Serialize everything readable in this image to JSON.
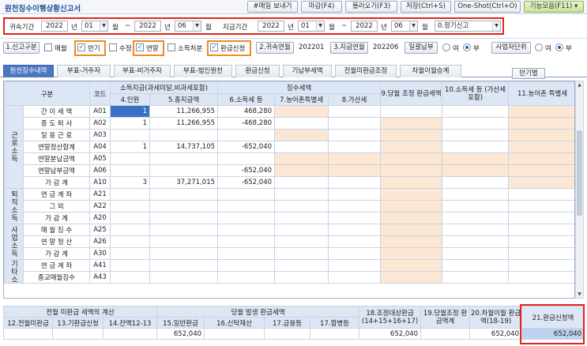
{
  "title": "원천징수이행상황신고서",
  "toolbar": {
    "email": "#메일 보내기",
    "close": "마감(F4)",
    "load": "불러오기(F3)",
    "save": "저장(Ctrl+S)",
    "oneshot": "One-Shot(Ctrl+O)",
    "func": "기능모음(F11)"
  },
  "period": {
    "label1": "귀속기간",
    "from_year": "2022",
    "from_month": "01",
    "to_year": "2022",
    "to_month": "06",
    "year": "년",
    "month": "월",
    "tilde": "~",
    "label2": "지급기간",
    "pay_from_year": "2022",
    "pay_from_month": "01",
    "pay_to_year": "2022",
    "pay_to_month": "06",
    "report_type": "0.정기신고"
  },
  "options": {
    "report_category_btn": "1.신고구분",
    "monthly": "매월",
    "semiannual": "반기",
    "amend": "수정",
    "yearend": "연말",
    "income_disposal": "소득처분",
    "refund": "환급신청",
    "attr_year_btn": "2.귀속연월",
    "attr_year_value": "202201",
    "pay_year_btn": "3.지급연월",
    "pay_year_value": "202206",
    "lump_btn": "일괄납부",
    "yes": "여",
    "no": "부",
    "biz_unit_btn": "사업자단위",
    "yes2": "여",
    "no2": "부"
  },
  "tabs": [
    "원천징수내역",
    "부표-거주자",
    "부표-비거주자",
    "부표-법인원천",
    "환급신청",
    "기납부세액",
    "전월미환급조정",
    "차월이월승계"
  ],
  "side_button": "반기별",
  "grid": {
    "headers": {
      "category": "구분",
      "code": "코드",
      "income_group": "소득지급(과세미달,비과세포함)",
      "withholding_group": "징수세액",
      "col4": "4.인원",
      "col5": "5.총지급액",
      "col6": "6.소득세 등",
      "col7": "7.농어촌특별세",
      "col8": "8.가산세",
      "col9": "9.당월 조정 환급세액",
      "col10": "10.소득세 등 (가산세 포함)",
      "col11": "11.농어촌 특별세"
    },
    "groups": {
      "earned": "근로소득",
      "retire": "퇴직소득",
      "business": "사업소득",
      "other": "기타소득"
    },
    "rows": [
      {
        "label": "간 이 세 액",
        "code": "A01",
        "persons": "1",
        "total": "11,266,955",
        "tax": "468,280"
      },
      {
        "label": "중 도 퇴 사",
        "code": "A02",
        "persons": "1",
        "total": "11,266,955",
        "tax": "-468,280"
      },
      {
        "label": "일 용 근 로",
        "code": "A03",
        "persons": "",
        "total": "",
        "tax": ""
      },
      {
        "label": "연말정산합계",
        "code": "A04",
        "persons": "1",
        "total": "14,737,105",
        "tax": "-652,040"
      },
      {
        "label": "연말분납금액",
        "code": "A05",
        "persons": "",
        "total": "",
        "tax": ""
      },
      {
        "label": "연말납부금액",
        "code": "A06",
        "persons": "",
        "total": "",
        "tax": "-652,040"
      },
      {
        "label": "가 감 계",
        "code": "A10",
        "persons": "3",
        "total": "37,271,015",
        "tax": "-652,040"
      },
      {
        "label": "연 금 계 좌",
        "code": "A21",
        "persons": "",
        "total": "",
        "tax": ""
      },
      {
        "label": "그 외",
        "code": "A22",
        "persons": "",
        "total": "",
        "tax": ""
      },
      {
        "label": "가 감 계",
        "code": "A20",
        "persons": "",
        "total": "",
        "tax": ""
      },
      {
        "label": "매 월 징 수",
        "code": "A25",
        "persons": "",
        "total": "",
        "tax": ""
      },
      {
        "label": "연 말 정 산",
        "code": "A26",
        "persons": "",
        "total": "",
        "tax": ""
      },
      {
        "label": "가 감 계",
        "code": "A30",
        "persons": "",
        "total": "",
        "tax": ""
      },
      {
        "label": "연 금 계 좌",
        "code": "A41",
        "persons": "",
        "total": "",
        "tax": ""
      },
      {
        "label": "종교매월징수",
        "code": "A43",
        "persons": "",
        "total": "",
        "tax": ""
      }
    ]
  },
  "summary": {
    "group1": "전월 미환급 세액의 계산",
    "group2": "당월 발생 환급세액",
    "c12": "12.전월미환급",
    "c13": "13.기환급신청",
    "c14": "14.잔액12-13",
    "c15": "15.일반환급",
    "c16": "16.신탁재산",
    "c17": "17.금융등",
    "c17b": "17.합병등",
    "c18": "18.조정대상환급 (14+15+16+17)",
    "c19": "19.당월조정 환급액계",
    "c20": "20.차월이월 환급액(18-19)",
    "c21": "21.환급신청액",
    "v15": "652,040",
    "v18": "652,040",
    "v20": "652,040",
    "v21": "652,040"
  }
}
